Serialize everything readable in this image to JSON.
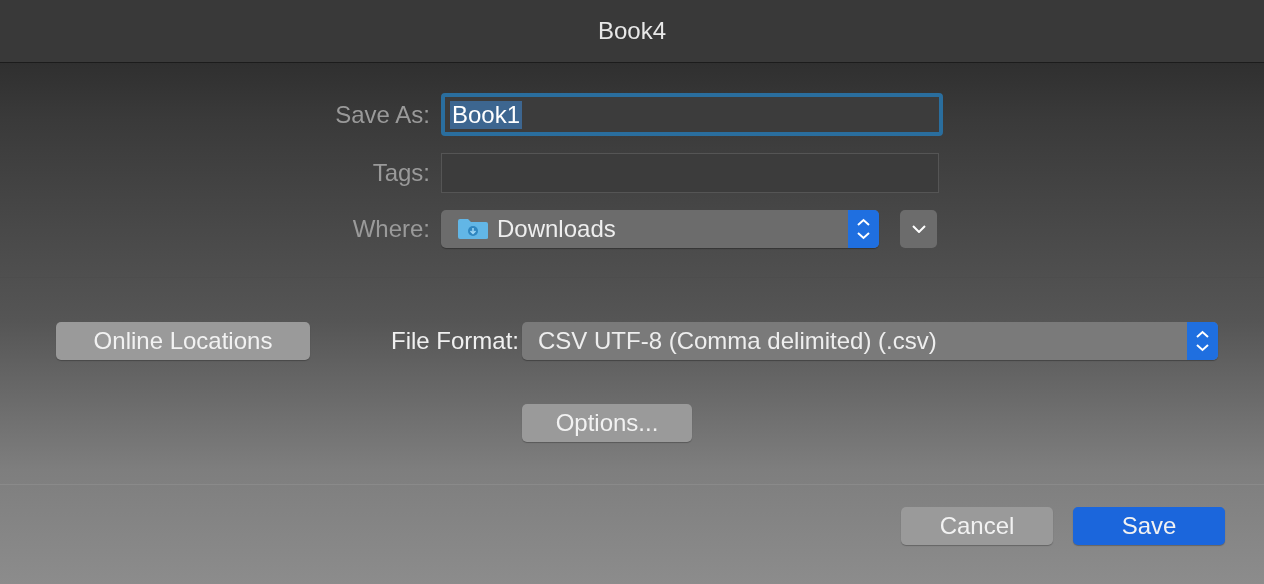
{
  "window": {
    "title": "Book4"
  },
  "save_as": {
    "label": "Save As:",
    "value": "Book1",
    "value_selected": true,
    "focused": true
  },
  "tags": {
    "label": "Tags:"
  },
  "where": {
    "label": "Where:",
    "value": "Downloads"
  },
  "online_locations": {
    "label": "Online Locations"
  },
  "file_format": {
    "label": "File Format:",
    "value": "CSV UTF-8 (Comma delimited) (.csv)"
  },
  "options": {
    "label": "Options..."
  },
  "buttons": [
    {
      "label": "Cancel",
      "kind": "secondary"
    },
    {
      "label": "Save",
      "kind": "primary"
    }
  ]
}
